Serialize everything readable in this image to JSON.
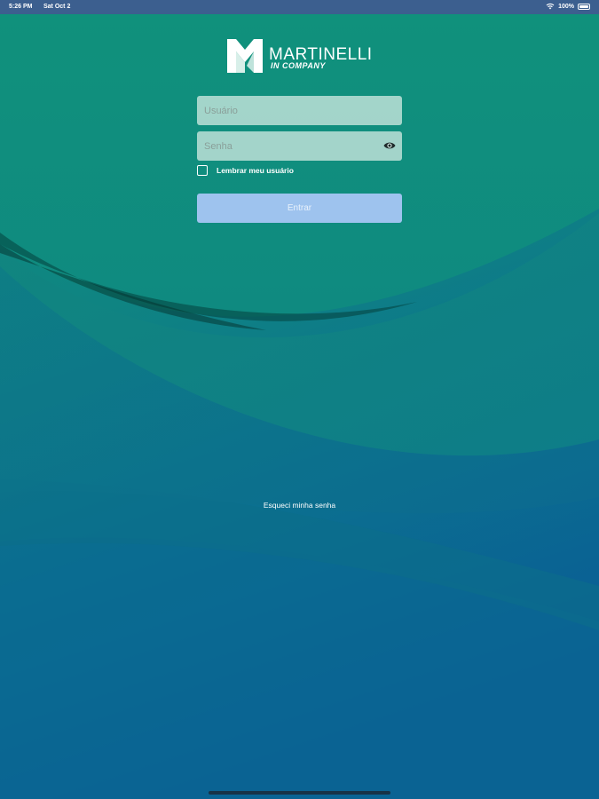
{
  "status_bar": {
    "time": "5:26 PM",
    "date": "Sat Oct 2",
    "battery": "100%",
    "wifi_icon": "wifi-icon",
    "battery_icon": "battery-icon"
  },
  "brand": {
    "name": "MARTINELLI",
    "subtitle": "IN COMPANY",
    "logo_icon": "martinelli-m-logo"
  },
  "login": {
    "username_placeholder": "Usuário",
    "username_value": "",
    "password_placeholder": "Senha",
    "password_value": "",
    "show_password_icon": "eye-icon",
    "remember_label": "Lembrar meu usuário",
    "remember_checked": false,
    "submit_label": "Entrar",
    "forgot_label": "Esqueci minha senha"
  },
  "colors": {
    "background_top": "#0f8c7e",
    "background_bottom": "#0a5f92",
    "button": "#9ec3ee",
    "status_bar": "#3c5f8f"
  }
}
